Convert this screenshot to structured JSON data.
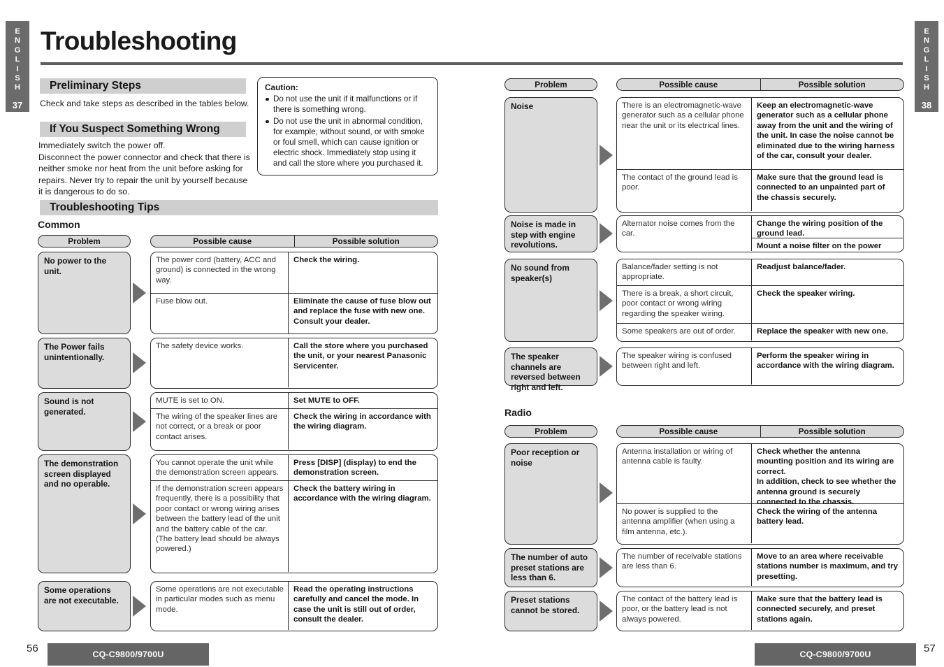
{
  "page": {
    "title": "Troubleshooting",
    "left_tab": {
      "letters": [
        "E",
        "N",
        "G",
        "L",
        "I",
        "S",
        "H"
      ],
      "page": "37"
    },
    "right_tab": {
      "letters": [
        "E",
        "N",
        "G",
        "L",
        "I",
        "S",
        "H"
      ],
      "page": "38"
    },
    "footer": {
      "left_page_number": "56",
      "right_page_number": "57",
      "model": "CQ-C9800/9700U"
    }
  },
  "preliminary": {
    "heading": "Preliminary Steps",
    "text": "Check and take steps as described in the tables below."
  },
  "suspect": {
    "heading": "If You Suspect Something Wrong",
    "text": "Immediately switch the power off.\nDisconnect the power connector and check that there is neither smoke nor heat from the unit before asking for repairs. Never try to repair the unit by yourself because it is dangerous to do so."
  },
  "caution": {
    "title": "Caution:",
    "items": [
      "Do not use the unit if it malfunctions or if there is something wrong.",
      "Do not use the unit in abnormal condition, for example, without sound, or with smoke or foul smell, which can cause ignition or electric shock. Immediately stop using it and call the store where you purchased it."
    ]
  },
  "tips": {
    "heading": "Troubleshooting Tips"
  },
  "columns": {
    "problem": "Problem",
    "possible_cause": "Possible cause",
    "possible_solution": "Possible solution"
  },
  "sections": {
    "common": {
      "label": "Common"
    },
    "radio": {
      "label": "Radio"
    }
  },
  "common_rows": [
    {
      "problem": "No power to the unit.",
      "entries": [
        {
          "cause": "The power cord (battery, ACC and ground) is connected in the wrong way.",
          "solution": "Check the wiring."
        },
        {
          "cause": "Fuse blow out.",
          "solution": "Eliminate the cause of fuse blow out and replace the fuse with new one. Consult your dealer."
        }
      ]
    },
    {
      "problem": "The Power fails unintentionally.",
      "entries": [
        {
          "cause": "The safety device works.",
          "solution": "Call the store where you purchased the unit, or your nearest Panasonic Servicenter."
        }
      ]
    },
    {
      "problem": "Sound is not generated.",
      "entries": [
        {
          "cause": "MUTE is set to ON.",
          "solution": "Set MUTE to OFF."
        },
        {
          "cause": "The wiring of the speaker lines are not correct, or a break or poor contact arises.",
          "solution": "Check the wiring in accordance with the wiring diagram."
        }
      ]
    },
    {
      "problem": "The demonstration screen displayed and no operable.",
      "entries": [
        {
          "cause": "You cannot operate the unit while the demonstration screen appears.",
          "solution": "Press [DISP] (display) to end the demonstration screen."
        },
        {
          "cause": "If the demonstration screen appears frequently, there is a possibility that poor contact or wrong wiring arises between the battery lead of the unit and the battery cable of the car.\n(The battery lead should be always powered.)",
          "solution": "Check the battery wiring in accordance with the wiring diagram."
        }
      ]
    },
    {
      "problem": "Some operations are not executable.",
      "entries": [
        {
          "cause": "Some operations are not executable in particular modes such as menu mode.",
          "solution": "Read the operating instructions carefully and cancel the mode. In case the unit is still out of order, consult the dealer."
        }
      ]
    }
  ],
  "common_rows_right": [
    {
      "problem": "Noise",
      "entries": [
        {
          "cause": "There is an electromagnetic-wave generator such as a cellular phone near the unit or its electrical lines.",
          "solution": "Keep an electromagnetic-wave generator such as a cellular phone away from the unit and the wiring of the unit. In case the noise cannot be eliminated due to the wiring harness of the car, consult your dealer."
        },
        {
          "cause": "The contact of the ground lead is poor.",
          "solution": "Make sure that the ground lead is connected to an unpainted part of the chassis securely."
        }
      ]
    },
    {
      "problem": "Noise is made in step with engine revolutions.",
      "entries": [
        {
          "cause": "Alternator noise comes from the car.",
          "solution_stack": [
            "Change the wiring position of the ground lead.",
            "Mount a noise filter on the power supply."
          ]
        }
      ]
    },
    {
      "problem": "No sound from speaker(s)",
      "entries": [
        {
          "cause": "Balance/fader setting is not appropriate.",
          "solution": "Readjust balance/fader."
        },
        {
          "cause": "There is a break, a short circuit, poor contact or wrong wiring regarding the speaker wiring.",
          "solution": "Check the speaker wiring."
        },
        {
          "cause": "Some speakers are out of order.",
          "solution": "Replace the speaker with new one."
        }
      ]
    },
    {
      "problem": "The speaker channels are reversed between right and left.",
      "entries": [
        {
          "cause": "The speaker wiring is confused between right and left.",
          "solution": "Perform the speaker wiring in accordance with the wiring diagram."
        }
      ]
    }
  ],
  "radio_rows": [
    {
      "problem": "Poor reception or noise",
      "entries": [
        {
          "cause": "Antenna installation or wiring of antenna cable is faulty.",
          "solution": "Check whether the antenna mounting position and its wiring are correct.\nIn addition, check to see whether the antenna ground is securely connected to the chassis."
        },
        {
          "cause": "No power is supplied to the antenna amplifier (when using a film antenna, etc.).",
          "solution": "Check the wiring of the antenna battery lead."
        }
      ]
    },
    {
      "problem": "The number of auto preset stations are less than 6.",
      "entries": [
        {
          "cause": "The number of receivable stations are less than 6.",
          "solution": "Move to an area where receivable stations number is maximum, and try presetting."
        }
      ]
    },
    {
      "problem": "Preset stations cannot be stored.",
      "entries": [
        {
          "cause": "The contact of the battery lead is poor, or the battery lead is not always powered.",
          "solution": "Make sure that the battery lead is connected securely, and preset stations again."
        }
      ]
    }
  ]
}
